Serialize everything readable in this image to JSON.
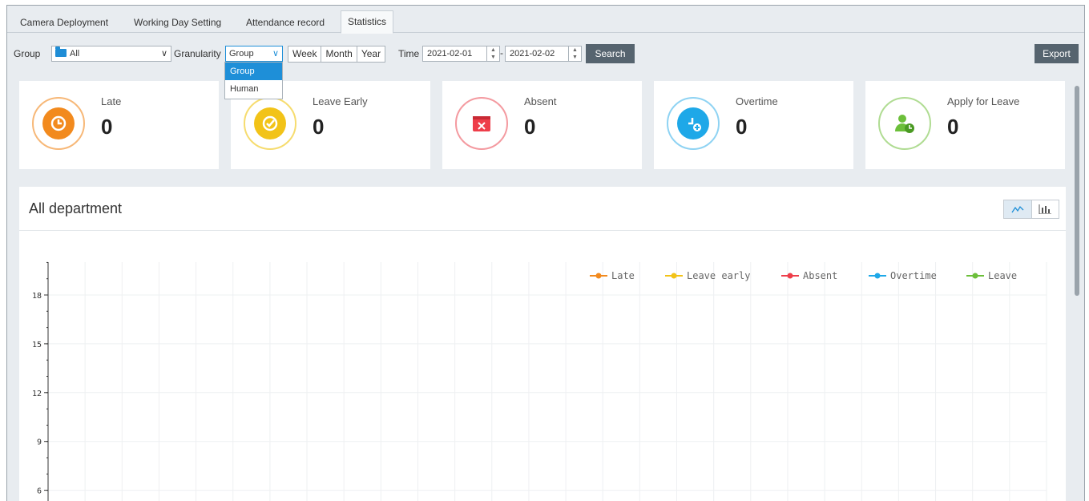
{
  "tabs": [
    {
      "label": "Camera Deployment",
      "active": false
    },
    {
      "label": "Working Day Setting",
      "active": false
    },
    {
      "label": "Attendance record",
      "active": false
    },
    {
      "label": "Statistics",
      "active": true
    }
  ],
  "toolbar": {
    "group_label": "Group",
    "group_value": "All",
    "granularity_label": "Granularity",
    "granularity_value": "Group",
    "granularity_options": [
      "Group",
      "Human"
    ],
    "period_buttons": [
      "Week",
      "Month",
      "Year"
    ],
    "time_label": "Time",
    "date_from": "2021-02-01",
    "date_to": "2021-02-02",
    "search_label": "Search",
    "export_label": "Export"
  },
  "stats": [
    {
      "label": "Late",
      "value": "0",
      "color": "#f28a1e",
      "icon": "clock-pin-icon"
    },
    {
      "label": "Leave Early",
      "value": "0",
      "color": "#f2c318",
      "icon": "check-pin-icon"
    },
    {
      "label": "Absent",
      "value": "0",
      "color": "#ee3e4a",
      "icon": "calendar-x-icon"
    },
    {
      "label": "Overtime",
      "value": "0",
      "color": "#1ea8e8",
      "icon": "clock-plus-icon"
    },
    {
      "label": "Apply for Leave",
      "value": "0",
      "color": "#6cbf3a",
      "icon": "user-clock-icon"
    }
  ],
  "panel": {
    "title": "All department"
  },
  "chart_data": {
    "type": "line",
    "title": "All department",
    "y_ticks": [
      6,
      9,
      12,
      15,
      18
    ],
    "ylim": [
      3,
      20
    ],
    "grid": true,
    "legend_position": "top-right",
    "series": [
      {
        "name": "Late",
        "color": "#f28a1e",
        "values": []
      },
      {
        "name": "Leave early",
        "color": "#f2c318",
        "values": []
      },
      {
        "name": "Absent",
        "color": "#ee3e4a",
        "values": []
      },
      {
        "name": "Overtime",
        "color": "#1ea8e8",
        "values": []
      },
      {
        "name": "Leave",
        "color": "#6cbf3a",
        "values": []
      }
    ]
  }
}
